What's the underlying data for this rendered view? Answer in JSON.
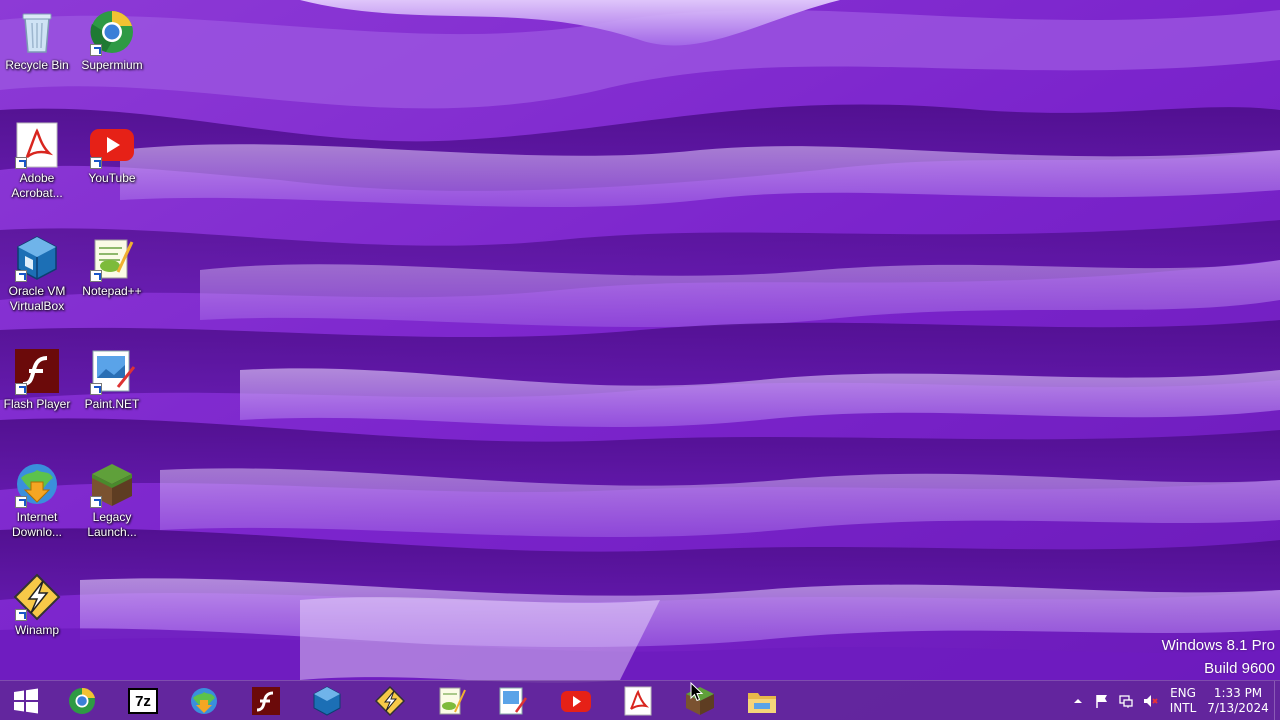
{
  "desktop": {
    "icons": [
      {
        "label": "Recycle Bin",
        "icon": "recycle-bin-icon"
      },
      {
        "label": "Supermium",
        "icon": "supermium-icon"
      },
      {
        "label": "Adobe Acrobat...",
        "icon": "adobe-acrobat-icon"
      },
      {
        "label": "YouTube",
        "icon": "youtube-icon"
      },
      {
        "label": "Oracle VM VirtualBox",
        "icon": "virtualbox-icon"
      },
      {
        "label": "Notepad++",
        "icon": "notepad-plus-plus-icon"
      },
      {
        "label": "Flash Player",
        "icon": "flash-player-icon"
      },
      {
        "label": "Paint.NET",
        "icon": "paint-net-icon"
      },
      {
        "label": "Internet Downlo...",
        "icon": "internet-download-manager-icon"
      },
      {
        "label": "Legacy Launch...",
        "icon": "legacy-launcher-icon"
      },
      {
        "label": "Winamp",
        "icon": "winamp-icon"
      }
    ]
  },
  "watermark": {
    "edition": "Windows 8.1 Pro",
    "build": "Build 9600"
  },
  "taskbar": {
    "start": "windows-start-icon",
    "pinned": [
      "supermium-icon",
      "7zip-icon",
      "internet-download-manager-icon",
      "flash-player-icon",
      "virtualbox-icon",
      "winamp-icon",
      "notepad-plus-plus-icon",
      "paint-net-icon",
      "youtube-icon",
      "adobe-acrobat-icon",
      "legacy-launcher-icon",
      "file-explorer-icon"
    ],
    "seven_zip_label": "7z",
    "tray": {
      "language_top": "ENG",
      "language_bottom": "INTL",
      "time": "1:33 PM",
      "date": "7/13/2024"
    }
  },
  "colors": {
    "wallpaper_base": "#7a22c8",
    "taskbar": "#602896",
    "youtube_red": "#e62117",
    "flash_red": "#6b0a0a"
  }
}
